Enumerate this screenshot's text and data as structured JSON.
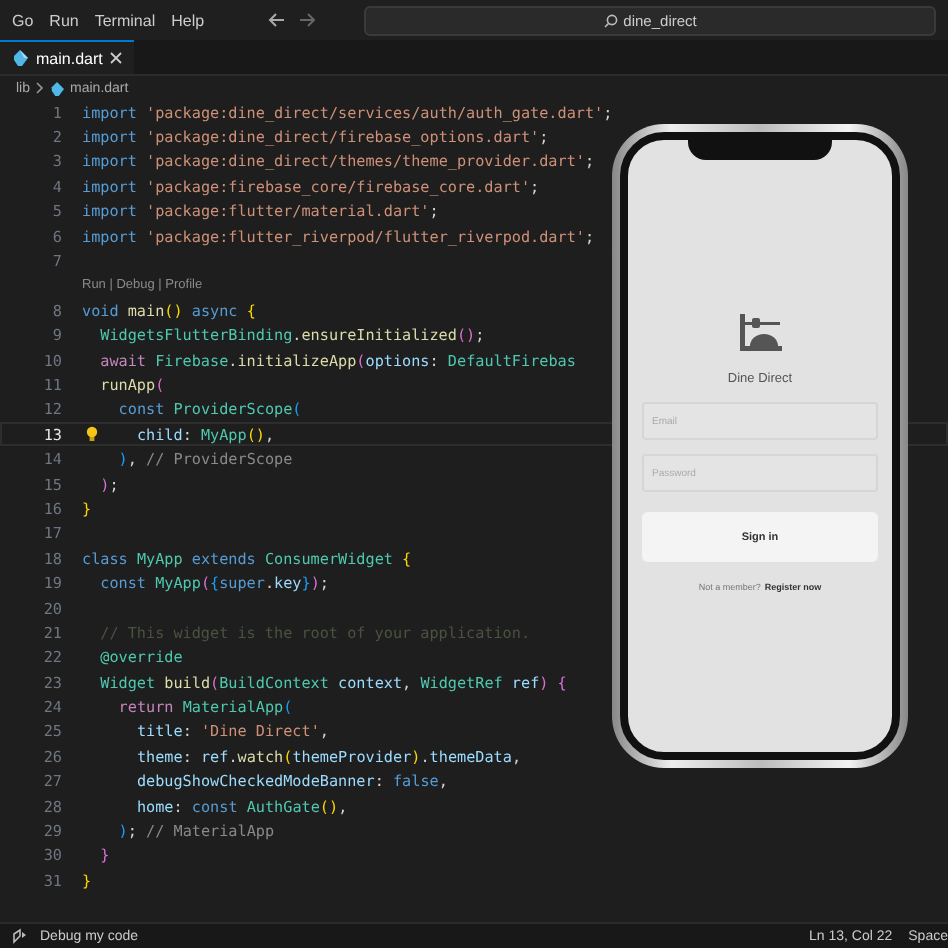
{
  "menu": [
    "Go",
    "Run",
    "Terminal",
    "Help"
  ],
  "search": {
    "value": "dine_direct"
  },
  "tabs": [
    {
      "label": "main.dart",
      "selected": true
    }
  ],
  "breadcrumb": [
    "lib",
    "main.dart"
  ],
  "lines": [
    {
      "kind": "code",
      "number": "1",
      "current": false,
      "tokens": [
        {
          "text": "import ",
          "kind": "keyword"
        },
        {
          "text": "'package:dine_direct/services/auth/auth_gate.dart'",
          "kind": "string"
        },
        {
          "text": ";",
          "kind": "plain"
        }
      ]
    },
    {
      "kind": "code",
      "number": "2",
      "current": false,
      "tokens": [
        {
          "text": "import ",
          "kind": "keyword"
        },
        {
          "text": "'package:dine_direct/firebase_options.dart'",
          "kind": "string"
        },
        {
          "text": ";",
          "kind": "plain"
        }
      ]
    },
    {
      "kind": "code",
      "number": "3",
      "current": false,
      "tokens": [
        {
          "text": "import ",
          "kind": "keyword"
        },
        {
          "text": "'package:dine_direct/themes/theme_provider.dart'",
          "kind": "string"
        },
        {
          "text": ";",
          "kind": "plain"
        }
      ]
    },
    {
      "kind": "code",
      "number": "4",
      "current": false,
      "tokens": [
        {
          "text": "import ",
          "kind": "keyword"
        },
        {
          "text": "'package:firebase_core/firebase_core.dart'",
          "kind": "string"
        },
        {
          "text": ";",
          "kind": "plain"
        }
      ]
    },
    {
      "kind": "code",
      "number": "5",
      "current": false,
      "tokens": [
        {
          "text": "import ",
          "kind": "keyword"
        },
        {
          "text": "'package:flutter/material.dart'",
          "kind": "string"
        },
        {
          "text": ";",
          "kind": "plain"
        }
      ]
    },
    {
      "kind": "code",
      "number": "6",
      "current": false,
      "tokens": [
        {
          "text": "import ",
          "kind": "keyword"
        },
        {
          "text": "'package:flutter_riverpod/flutter_riverpod.dart'",
          "kind": "string"
        },
        {
          "text": ";",
          "kind": "plain"
        }
      ]
    },
    {
      "kind": "code",
      "number": "7",
      "current": false
    },
    {
      "kind": "codelens",
      "text": "Run | Debug | Profile"
    },
    {
      "kind": "code",
      "number": "8",
      "current": false,
      "tokens": [
        {
          "text": "void ",
          "kind": "keyword"
        },
        {
          "text": "main",
          "kind": "function"
        },
        {
          "text": "()",
          "kind": "brace1"
        },
        {
          "text": " async ",
          "kind": "keyword"
        },
        {
          "text": "{",
          "kind": "brace1"
        }
      ]
    },
    {
      "kind": "code",
      "number": "9",
      "current": false,
      "tokens": [
        {
          "text": "  WidgetsFlutterBinding",
          "kind": "type"
        },
        {
          "text": ".",
          "kind": "plain"
        },
        {
          "text": "ensureInitialized",
          "kind": "function"
        },
        {
          "text": "()",
          "kind": "brace2"
        },
        {
          "text": ";",
          "kind": "plain"
        }
      ]
    },
    {
      "kind": "code",
      "number": "10",
      "current": false,
      "tokens": [
        {
          "text": "  await ",
          "kind": "control"
        },
        {
          "text": "Firebase",
          "kind": "type"
        },
        {
          "text": ".",
          "kind": "plain"
        },
        {
          "text": "initializeApp",
          "kind": "function"
        },
        {
          "text": "(",
          "kind": "brace2"
        },
        {
          "text": "options",
          "kind": "param"
        },
        {
          "text": ": ",
          "kind": "plain"
        },
        {
          "text": "DefaultFirebas",
          "kind": "type"
        }
      ]
    },
    {
      "kind": "code",
      "number": "11",
      "current": false,
      "tokens": [
        {
          "text": "  runApp",
          "kind": "function"
        },
        {
          "text": "(",
          "kind": "brace2"
        }
      ]
    },
    {
      "kind": "code",
      "number": "12",
      "current": false,
      "tokens": [
        {
          "text": "    const ",
          "kind": "keyword"
        },
        {
          "text": "ProviderScope",
          "kind": "type"
        },
        {
          "text": "(",
          "kind": "brace3"
        }
      ]
    },
    {
      "kind": "code",
      "number": "13",
      "current": true,
      "tokens": [
        {
          "text": "      child",
          "kind": "param"
        },
        {
          "text": ": ",
          "kind": "plain"
        },
        {
          "text": "MyApp",
          "kind": "type"
        },
        {
          "text": "()",
          "kind": "brace1"
        },
        {
          "text": ",",
          "kind": "plain"
        }
      ]
    },
    {
      "kind": "code",
      "number": "14",
      "current": false,
      "tokens": [
        {
          "text": "    )",
          "kind": "brace3"
        },
        {
          "text": ", ",
          "kind": "plain"
        },
        {
          "text": "// ProviderScope",
          "kind": "label"
        }
      ]
    },
    {
      "kind": "code",
      "number": "15",
      "current": false,
      "tokens": [
        {
          "text": "  )",
          "kind": "brace2"
        },
        {
          "text": ";",
          "kind": "plain"
        }
      ]
    },
    {
      "kind": "code",
      "number": "16",
      "current": false,
      "tokens": [
        {
          "text": "}",
          "kind": "brace1"
        }
      ]
    },
    {
      "kind": "code",
      "number": "17",
      "current": false
    },
    {
      "kind": "code",
      "number": "18",
      "current": false,
      "tokens": [
        {
          "text": "class ",
          "kind": "keyword"
        },
        {
          "text": "MyApp",
          "kind": "type"
        },
        {
          "text": " extends ",
          "kind": "keyword"
        },
        {
          "text": "ConsumerWidget ",
          "kind": "type"
        },
        {
          "text": "{",
          "kind": "brace1"
        }
      ]
    },
    {
      "kind": "code",
      "number": "19",
      "current": false,
      "tokens": [
        {
          "text": "  const ",
          "kind": "keyword"
        },
        {
          "text": "MyApp",
          "kind": "type"
        },
        {
          "text": "(",
          "kind": "brace2"
        },
        {
          "text": "{",
          "kind": "brace3"
        },
        {
          "text": "super",
          "kind": "keyword"
        },
        {
          "text": ".",
          "kind": "plain"
        },
        {
          "text": "key",
          "kind": "param"
        },
        {
          "text": "}",
          "kind": "brace3"
        },
        {
          "text": ")",
          "kind": "brace2"
        },
        {
          "text": ";",
          "kind": "plain"
        }
      ]
    },
    {
      "kind": "code",
      "number": "20",
      "current": false
    },
    {
      "kind": "code",
      "number": "21",
      "current": false,
      "tokens": [
        {
          "text": "  // This widget is the root of your application.",
          "kind": "comment"
        }
      ]
    },
    {
      "kind": "code",
      "number": "22",
      "current": false,
      "tokens": [
        {
          "text": "  @override",
          "kind": "type"
        }
      ]
    },
    {
      "kind": "code",
      "number": "23",
      "current": false,
      "tokens": [
        {
          "text": "  Widget ",
          "kind": "type"
        },
        {
          "text": "build",
          "kind": "function"
        },
        {
          "text": "(",
          "kind": "brace2"
        },
        {
          "text": "BuildContext ",
          "kind": "type"
        },
        {
          "text": "context",
          "kind": "param"
        },
        {
          "text": ", ",
          "kind": "plain"
        },
        {
          "text": "WidgetRef ",
          "kind": "type"
        },
        {
          "text": "ref",
          "kind": "param"
        },
        {
          "text": ") {",
          "kind": "brace2"
        }
      ]
    },
    {
      "kind": "code",
      "number": "24",
      "current": false,
      "tokens": [
        {
          "text": "    return ",
          "kind": "control"
        },
        {
          "text": "MaterialApp",
          "kind": "type"
        },
        {
          "text": "(",
          "kind": "brace3"
        }
      ]
    },
    {
      "kind": "code",
      "number": "25",
      "current": false,
      "tokens": [
        {
          "text": "      title",
          "kind": "param"
        },
        {
          "text": ": ",
          "kind": "plain"
        },
        {
          "text": "'Dine Direct'",
          "kind": "string"
        },
        {
          "text": ",",
          "kind": "plain"
        }
      ]
    },
    {
      "kind": "code",
      "number": "26",
      "current": false,
      "tokens": [
        {
          "text": "      theme",
          "kind": "param"
        },
        {
          "text": ": ",
          "kind": "plain"
        },
        {
          "text": "ref",
          "kind": "param"
        },
        {
          "text": ".",
          "kind": "plain"
        },
        {
          "text": "watch",
          "kind": "function"
        },
        {
          "text": "(",
          "kind": "brace1"
        },
        {
          "text": "themeProvider",
          "kind": "param"
        },
        {
          "text": ")",
          "kind": "brace1"
        },
        {
          "text": ".",
          "kind": "plain"
        },
        {
          "text": "themeData",
          "kind": "param"
        },
        {
          "text": ",",
          "kind": "plain"
        }
      ]
    },
    {
      "kind": "code",
      "number": "27",
      "current": false,
      "tokens": [
        {
          "text": "      debugShowCheckedModeBanner",
          "kind": "param"
        },
        {
          "text": ": ",
          "kind": "plain"
        },
        {
          "text": "false",
          "kind": "keyword"
        },
        {
          "text": ",",
          "kind": "plain"
        }
      ]
    },
    {
      "kind": "code",
      "number": "28",
      "current": false,
      "tokens": [
        {
          "text": "      home",
          "kind": "param"
        },
        {
          "text": ": ",
          "kind": "plain"
        },
        {
          "text": "const ",
          "kind": "keyword"
        },
        {
          "text": "AuthGate",
          "kind": "type"
        },
        {
          "text": "()",
          "kind": "brace1"
        },
        {
          "text": ",",
          "kind": "plain"
        }
      ]
    },
    {
      "kind": "code",
      "number": "29",
      "current": false,
      "tokens": [
        {
          "text": "    )",
          "kind": "brace3"
        },
        {
          "text": "; ",
          "kind": "plain"
        },
        {
          "text": "// MaterialApp",
          "kind": "label"
        }
      ]
    },
    {
      "kind": "code",
      "number": "30",
      "current": false,
      "tokens": [
        {
          "text": "  }",
          "kind": "brace2"
        }
      ]
    },
    {
      "kind": "code",
      "number": "31",
      "current": false,
      "tokens": [
        {
          "text": "}",
          "kind": "brace1"
        }
      ]
    }
  ],
  "phone": {
    "app_title": "Dine Direct",
    "email": {
      "placeholder": "Email"
    },
    "password": {
      "placeholder": "Password"
    },
    "sign_in": "Sign in",
    "not_member": "Not a member?",
    "register_link": "Register now"
  },
  "status_bar": {
    "left": "Debug my code",
    "position": "Ln 13, Col 22",
    "indent": "Space"
  }
}
